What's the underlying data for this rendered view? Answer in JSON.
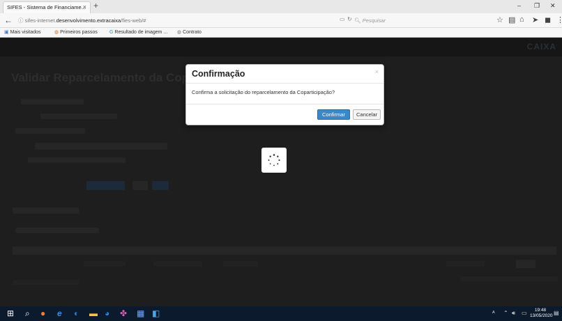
{
  "browser": {
    "tab_title": "SIFES - Sistema de Financiame...",
    "tab_close": "×",
    "new_tab": "+",
    "url_prefix": "sifes-internet.",
    "url_domain": "desenvolvimento.extracaixa",
    "url_path": "/fies-web/#",
    "search_placeholder": "Pesquisar",
    "window_controls": {
      "minimize": "–",
      "restore": "❐",
      "close": "✕"
    },
    "bookmarks": [
      "Mais visitados",
      "Primeiros passos",
      "Resultado de imagem ...",
      "Contrato"
    ]
  },
  "page": {
    "brand": "CAIXA",
    "title": "Validar Reparcelamento da Copar"
  },
  "modal": {
    "title": "Confirmação",
    "close": "×",
    "message": "Confirma a solicitação do reparcelamento da Coparticipação?",
    "confirm_label": "Confirmar",
    "cancel_label": "Cancelar",
    "confirm_color": "#3a87ca"
  },
  "taskbar": {
    "time": "19:48",
    "date": "13/05/2020"
  }
}
